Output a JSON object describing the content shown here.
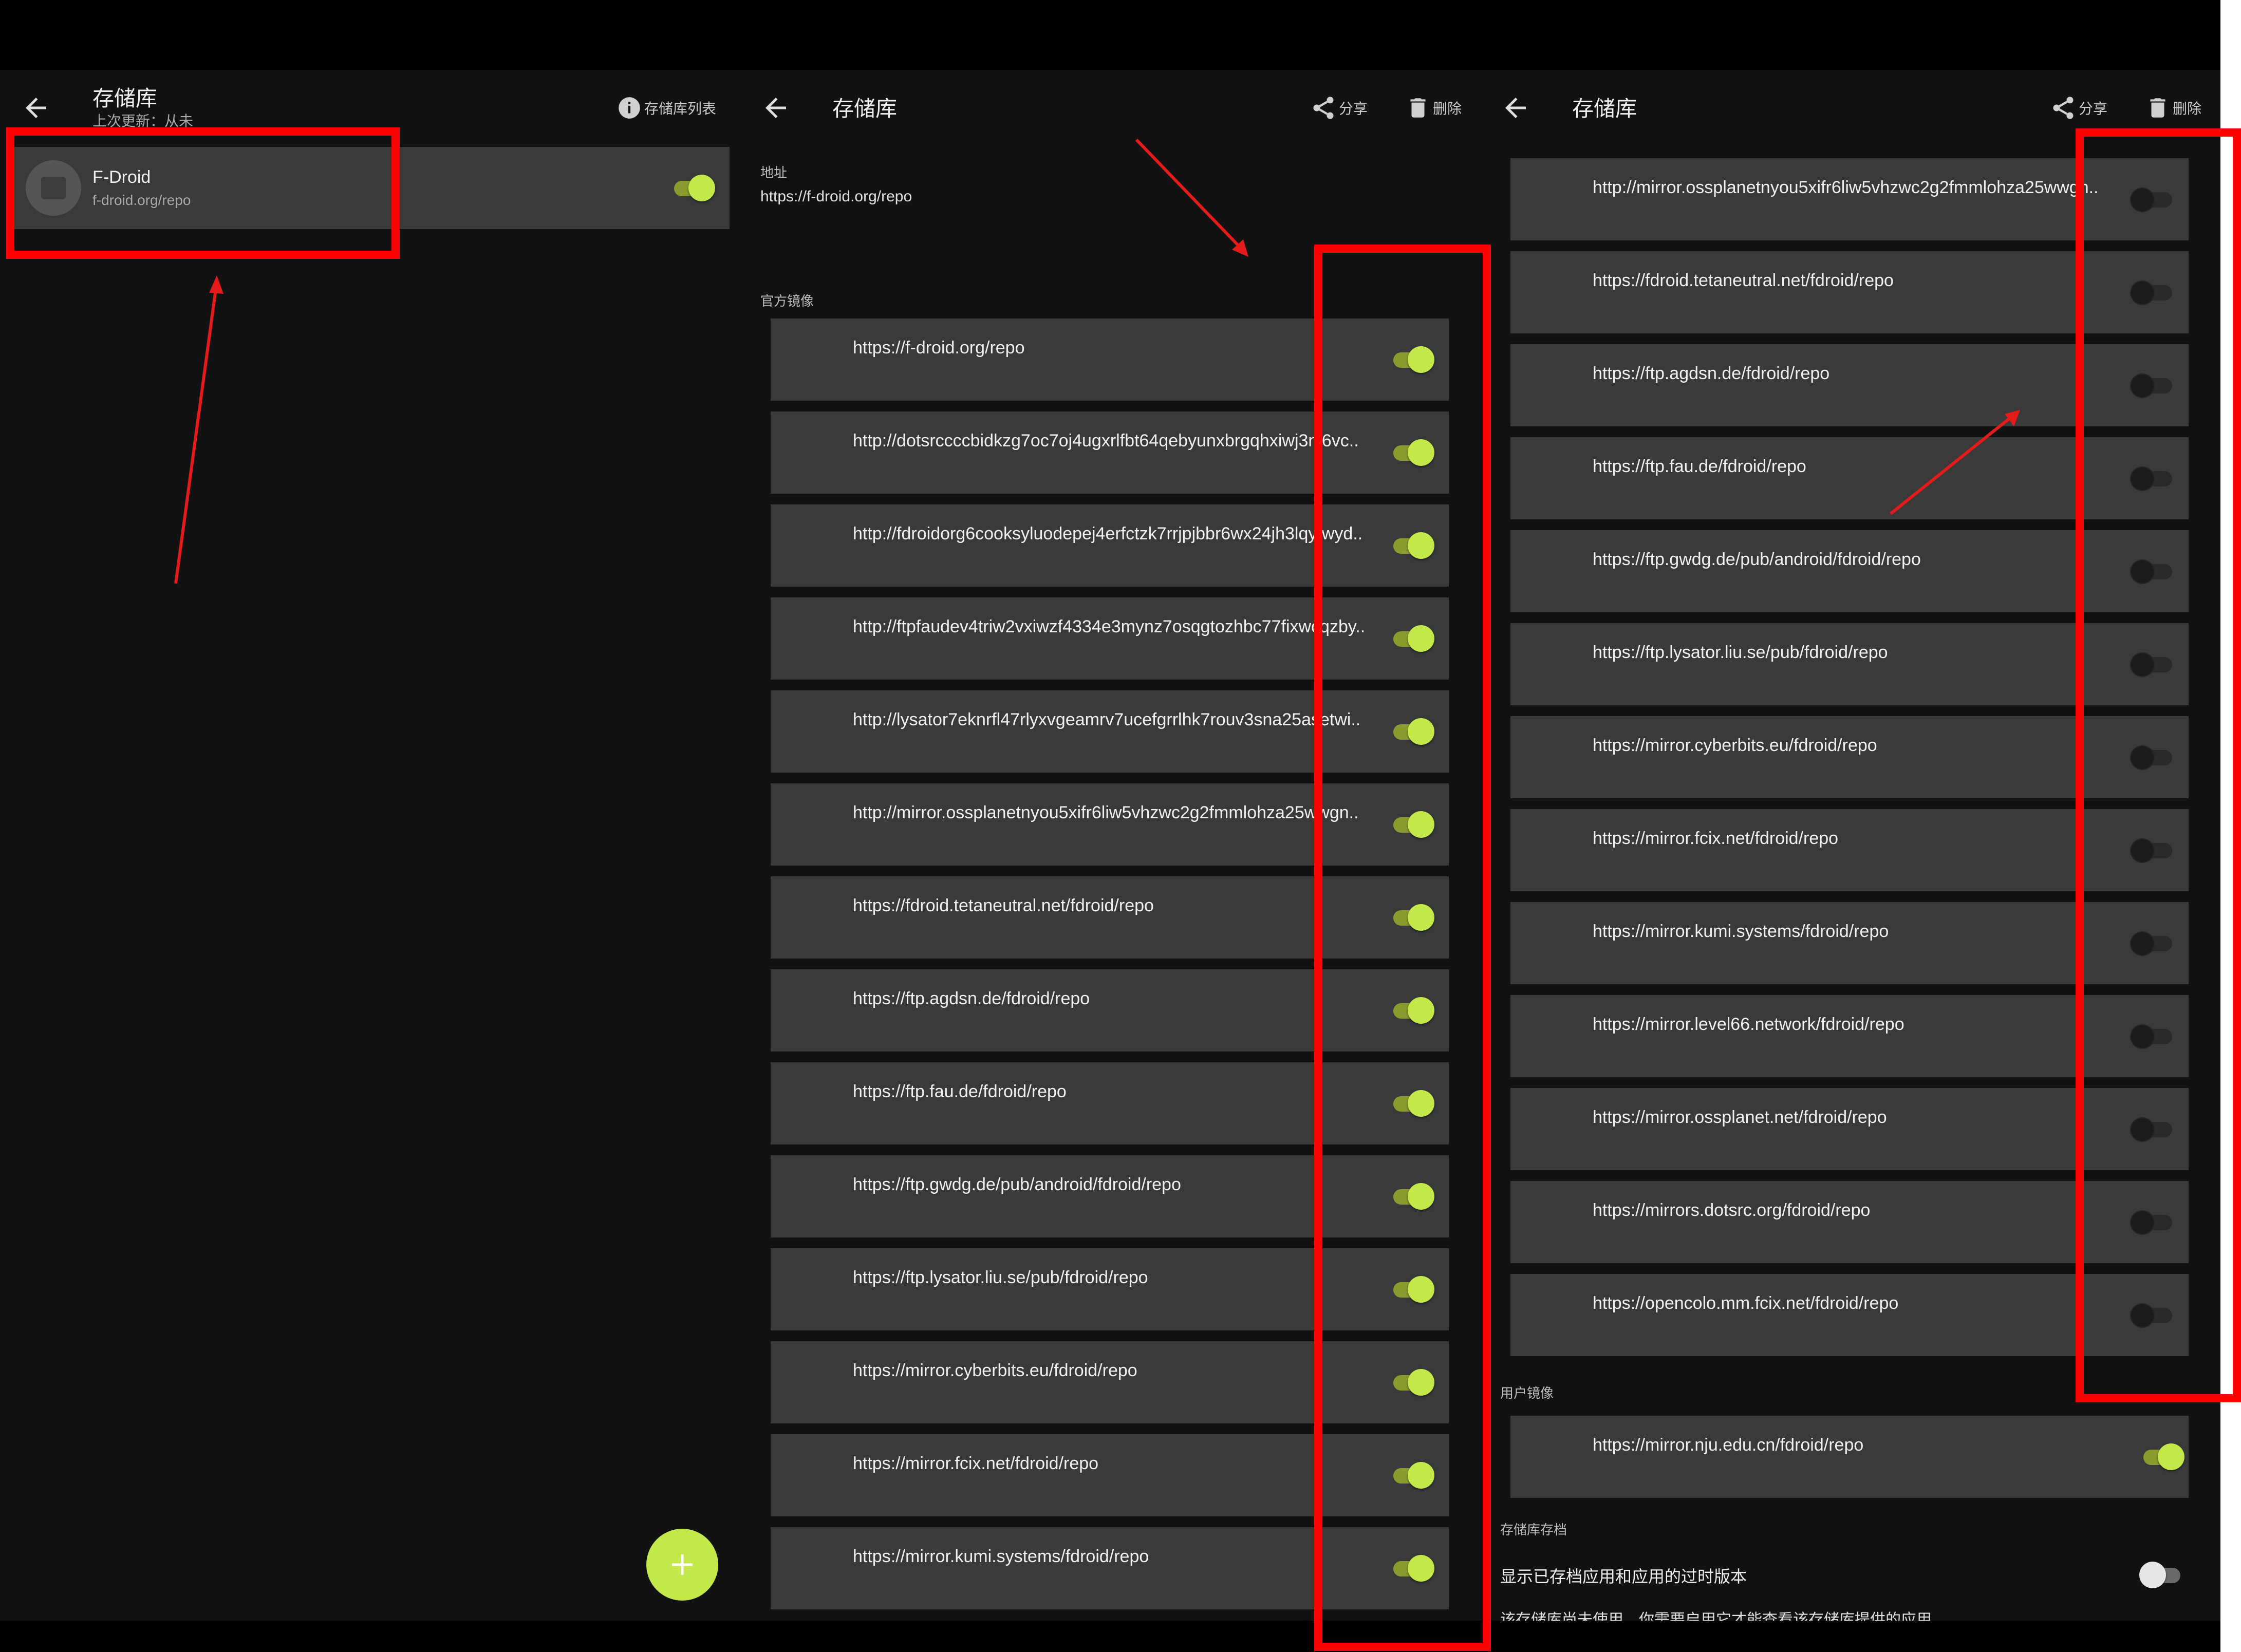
{
  "colors": {
    "accent": "#c3e84a",
    "surface": "#3a3a3a",
    "background": "#121212",
    "annotation": "#ff0000"
  },
  "panel1": {
    "title": "存储库",
    "subtitle": "上次更新：从未",
    "action_label": "存储库列表",
    "action_icon": "info-icon",
    "repo": {
      "name": "F-Droid",
      "url": "f-droid.org/repo",
      "enabled": true
    },
    "fab_icon": "plus-icon"
  },
  "panel2": {
    "title": "存储库",
    "share_label": "分享",
    "delete_label": "删除",
    "address_label": "地址",
    "address_value": "https://f-droid.org/repo",
    "official_label": "官方镜像",
    "mirrors": [
      {
        "url": "https://f-droid.org/repo",
        "enabled": true
      },
      {
        "url": "http://dotsrccccbidkzg7oc7oj4ugxrlfbt64qebyunxbrgqhxiwj3nl6vc..",
        "enabled": true
      },
      {
        "url": "http://fdroidorg6cooksyluodepej4erfctzk7rrjpjbbr6wx24jh3lqyfwyd..",
        "enabled": true
      },
      {
        "url": "http://ftpfaudev4triw2vxiwzf4334e3mynz7osqgtozhbc77fixwcqzby..",
        "enabled": true
      },
      {
        "url": "http://lysator7eknrfl47rlyxvgeamrv7ucefgrrlhk7rouv3sna25asetwi..",
        "enabled": true
      },
      {
        "url": "http://mirror.ossplanetnyou5xifr6liw5vhzwc2g2fmmlohza25wwgn..",
        "enabled": true
      },
      {
        "url": "https://fdroid.tetaneutral.net/fdroid/repo",
        "enabled": true
      },
      {
        "url": "https://ftp.agdsn.de/fdroid/repo",
        "enabled": true
      },
      {
        "url": "https://ftp.fau.de/fdroid/repo",
        "enabled": true
      },
      {
        "url": "https://ftp.gwdg.de/pub/android/fdroid/repo",
        "enabled": true
      },
      {
        "url": "https://ftp.lysator.liu.se/pub/fdroid/repo",
        "enabled": true
      },
      {
        "url": "https://mirror.cyberbits.eu/fdroid/repo",
        "enabled": true
      },
      {
        "url": "https://mirror.fcix.net/fdroid/repo",
        "enabled": true
      },
      {
        "url": "https://mirror.kumi.systems/fdroid/repo",
        "enabled": true
      }
    ]
  },
  "panel3": {
    "title": "存储库",
    "share_label": "分享",
    "delete_label": "删除",
    "mirrors": [
      {
        "url": "http://mirror.ossplanetnyou5xifr6liw5vhzwc2g2fmmlohza25wwgn..",
        "enabled": false
      },
      {
        "url": "https://fdroid.tetaneutral.net/fdroid/repo",
        "enabled": false
      },
      {
        "url": "https://ftp.agdsn.de/fdroid/repo",
        "enabled": false
      },
      {
        "url": "https://ftp.fau.de/fdroid/repo",
        "enabled": false
      },
      {
        "url": "https://ftp.gwdg.de/pub/android/fdroid/repo",
        "enabled": false
      },
      {
        "url": "https://ftp.lysator.liu.se/pub/fdroid/repo",
        "enabled": false
      },
      {
        "url": "https://mirror.cyberbits.eu/fdroid/repo",
        "enabled": false
      },
      {
        "url": "https://mirror.fcix.net/fdroid/repo",
        "enabled": false
      },
      {
        "url": "https://mirror.kumi.systems/fdroid/repo",
        "enabled": false
      },
      {
        "url": "https://mirror.level66.network/fdroid/repo",
        "enabled": false
      },
      {
        "url": "https://mirror.ossplanet.net/fdroid/repo",
        "enabled": false
      },
      {
        "url": "https://mirrors.dotsrc.org/fdroid/repo",
        "enabled": false
      },
      {
        "url": "https://opencolo.mm.fcix.net/fdroid/repo",
        "enabled": false
      }
    ],
    "user_mirror_label": "用户镜像",
    "user_mirror": {
      "url": "https://mirror.nju.edu.cn/fdroid/repo",
      "enabled": true
    },
    "archive_label": "存储库存档",
    "archive_toggle_text": "显示已存档应用和应用的过时版本",
    "archive_enabled": false,
    "archive_note": "该存储库尚未使用。你需要启用它才能查看该存储库提供的应用。"
  }
}
